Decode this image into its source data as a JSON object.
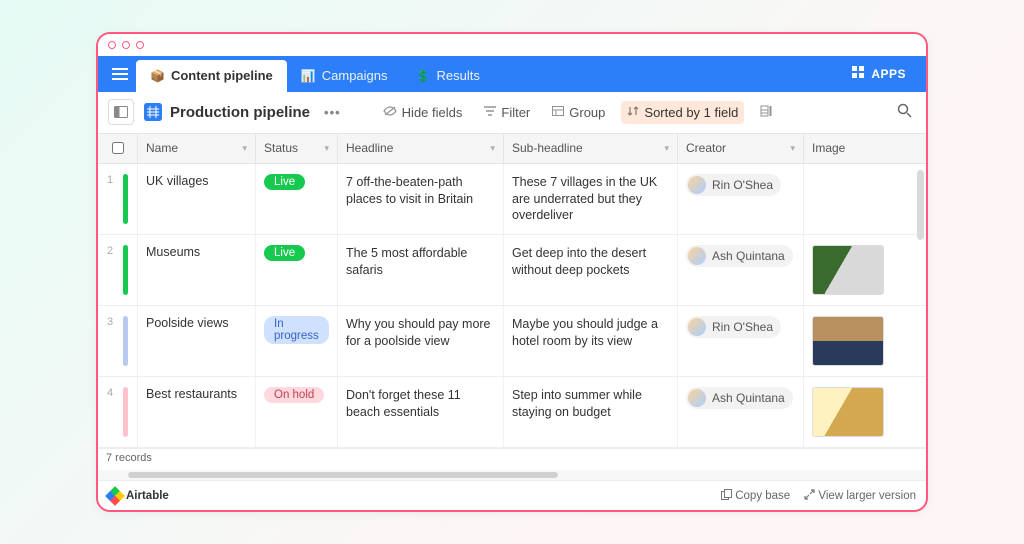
{
  "tabs": [
    {
      "label": "Content pipeline",
      "active": true
    },
    {
      "label": "Campaigns",
      "active": false
    },
    {
      "label": "Results",
      "active": false
    }
  ],
  "apps_label": "APPS",
  "view": {
    "name": "Production pipeline"
  },
  "toolbar": {
    "hide_fields": "Hide fields",
    "filter": "Filter",
    "group": "Group",
    "sorted": "Sorted by 1 field"
  },
  "columns": {
    "name": "Name",
    "status": "Status",
    "headline": "Headline",
    "sub": "Sub-headline",
    "creator": "Creator",
    "image": "Image"
  },
  "rows": [
    {
      "num": "1",
      "bar_color": "#18c950",
      "name": "UK villages",
      "status_label": "Live",
      "status_class": "live",
      "headline": "7 off-the-beaten-path places to visit in Britain",
      "sub": "These 7 villages in the UK are underrated but they overdeliver",
      "creator": "Rin O'Shea",
      "has_image": false
    },
    {
      "num": "2",
      "bar_color": "#18c950",
      "name": "Museums",
      "status_label": "Live",
      "status_class": "live",
      "headline": "The 5 most affordable safaris",
      "sub": "Get deep into the desert without deep pockets",
      "creator": "Ash Quintana",
      "has_image": true,
      "thumb_class": "t1"
    },
    {
      "num": "3",
      "bar_color": "#b9c9ef",
      "name": "Poolside views",
      "status_label": "In progress",
      "status_class": "progress",
      "headline": "Why you should pay more for a poolside view",
      "sub": "Maybe you should judge a hotel room by its view",
      "creator": "Rin O'Shea",
      "has_image": true,
      "thumb_class": "t2"
    },
    {
      "num": "4",
      "bar_color": "#ffc1cb",
      "name": "Best restaurants",
      "status_label": "On hold",
      "status_class": "hold",
      "headline": "Don't forget these 11 beach essentials",
      "sub": "Step into summer while staying on budget",
      "creator": "Ash Quintana",
      "has_image": true,
      "thumb_class": "t3"
    }
  ],
  "record_count": "7 records",
  "brand": "Airtable",
  "footer": {
    "copy": "Copy base",
    "larger": "View larger version"
  }
}
